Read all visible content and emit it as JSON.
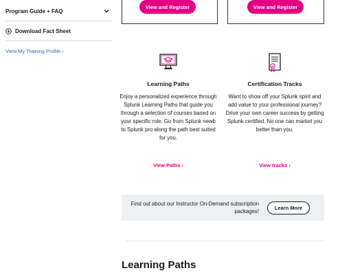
{
  "sidebar": {
    "faq_label": "Program Guide + FAQ",
    "download_label": "Download Fact Sheet",
    "profile_link": "View My Training Profile ›"
  },
  "cards": [
    {
      "button_label": "View and Register"
    },
    {
      "button_label": "View and Register"
    }
  ],
  "features": [
    {
      "title": "Learning Paths",
      "description": "Enjoy a personalized experience through Splunk Learning Paths that guide you through a selection of courses based on your specific role. Go from Splunk newb to Splunk pro along the path best suited for you.",
      "link": "View Paths ›",
      "icon": "monitor-graduation-cap-icon"
    },
    {
      "title": "Certification Tracks",
      "description": "Want to show off your Splunk spirit and add value to your professional journey? Drive your own career success by getting Splunk certified. No one can market you better than you.",
      "link": "View tracks ›",
      "icon": "certificate-document-icon"
    }
  ],
  "banner": {
    "text": "Find out about our Instructor On-Demand subscription packages!",
    "button_label": "Learn More"
  },
  "section_title": "Learning Paths",
  "colors": {
    "accent": "#e20082",
    "link": "#1f6fb5",
    "banner_bg": "#eef1f4"
  }
}
